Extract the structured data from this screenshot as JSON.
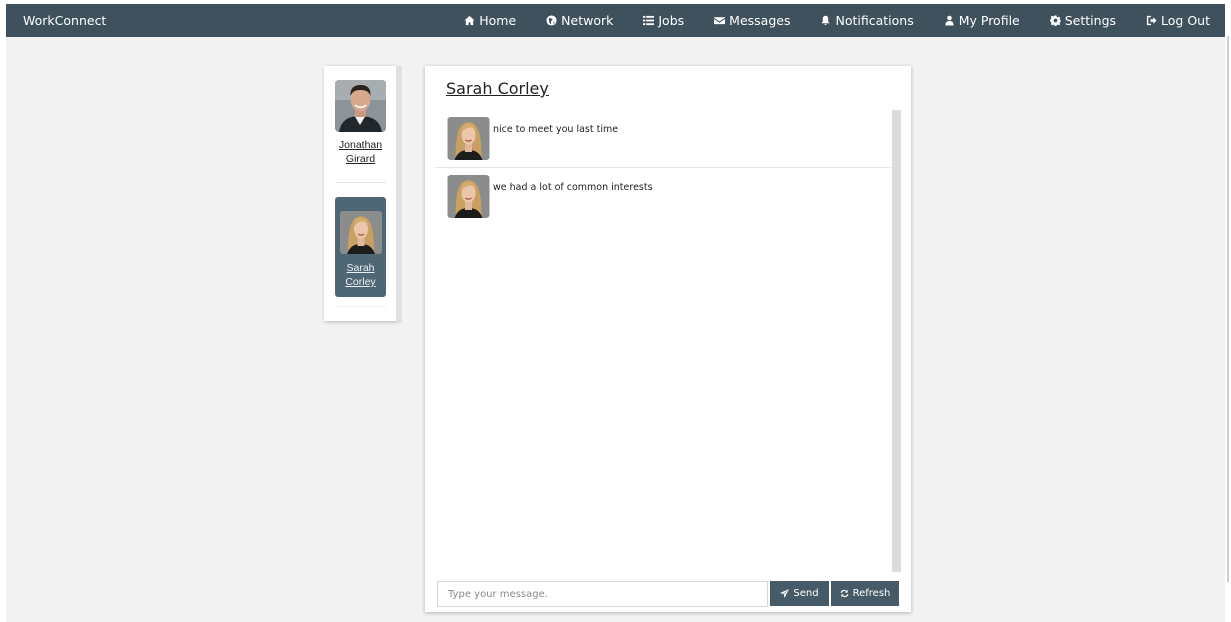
{
  "app": {
    "brand": "WorkConnect"
  },
  "nav": {
    "items": [
      {
        "label": "Home",
        "icon": "home-icon"
      },
      {
        "label": "Network",
        "icon": "globe-icon"
      },
      {
        "label": "Jobs",
        "icon": "list-icon"
      },
      {
        "label": "Messages",
        "icon": "envelope-icon"
      },
      {
        "label": "Notifications",
        "icon": "bell-icon"
      },
      {
        "label": "My Profile",
        "icon": "user-icon"
      },
      {
        "label": "Settings",
        "icon": "gear-icon"
      },
      {
        "label": "Log Out",
        "icon": "logout-icon"
      }
    ]
  },
  "contacts": [
    {
      "first": "Jonathan",
      "last": "Girard",
      "active": false
    },
    {
      "first": "Sarah",
      "last": "Corley",
      "active": true
    }
  ],
  "conversation": {
    "title": "Sarah Corley",
    "messages": [
      {
        "text": "nice to meet you last time"
      },
      {
        "text": "we had a lot of common interests"
      }
    ]
  },
  "composer": {
    "placeholder": "Type your message.",
    "send_label": "Send",
    "refresh_label": "Refresh"
  },
  "colors": {
    "navbar": "#3f515c",
    "active_contact": "#4f6775",
    "button": "#465b67",
    "page_background": "#f2f2f2"
  }
}
